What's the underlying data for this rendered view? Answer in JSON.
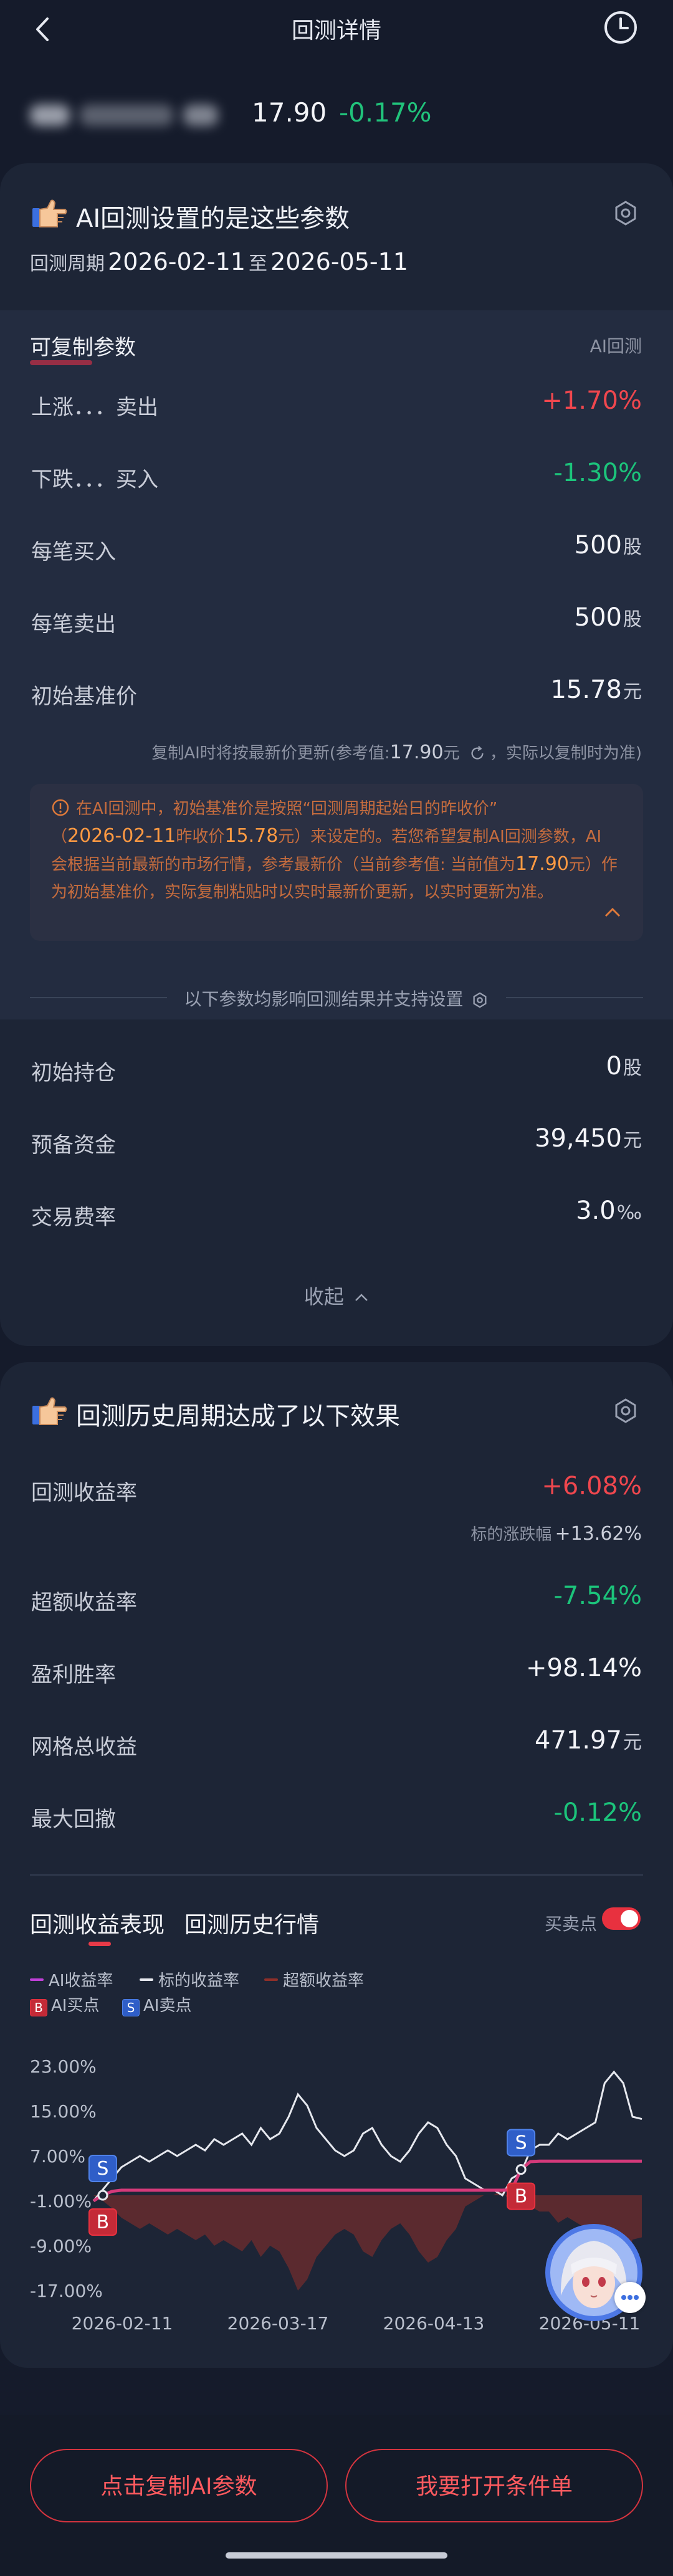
{
  "header": {
    "title": "回测详情"
  },
  "stock": {
    "price": "17.90",
    "change": "-0.17%"
  },
  "settings_card": {
    "title": "AI回测设置的是这些参数",
    "period_label": "回测周期",
    "period_start": "2026-02-11",
    "period_to": "至",
    "period_end": "2026-05-11",
    "copy_params_label": "可复制参数",
    "ai_tag": "AI回测",
    "rows": [
      {
        "label": "上涨．．．卖出",
        "value": "+1.70%",
        "unit": ""
      },
      {
        "label": "下跌．．．买入",
        "value": "-1.30%",
        "unit": ""
      },
      {
        "label": "每笔买入",
        "value": "500",
        "unit": "股"
      },
      {
        "label": "每笔卖出",
        "value": "500",
        "unit": "股"
      },
      {
        "label": "初始基准价",
        "value": "15.78",
        "unit": "元"
      }
    ],
    "ref_note_a": "复制AI时将按最新价更新(参考值:",
    "ref_note_value": "17.90",
    "ref_note_unit": "元",
    "ref_note_b": "，实际以复制时为准)",
    "notice": {
      "p1": "在AI回测中，初始基准价是按照“回测周期起始日的昨收价”",
      "p2_open": "（",
      "date": "2026-02-11",
      "p2_mid": "昨收价",
      "price": "15.78",
      "p2_tail": "元）来设定的。若您希望复制AI回测参数，AI",
      "p3": "会根据当前最新的市场行情，参考最新价（当前参考值: 当前值为",
      "ref": "17.90",
      "p3_tail": "元）作",
      "p4": "为初始基准价，实际复制粘贴时以实时最新价更新，以实时更新为准。"
    },
    "divider_text": "以下参数均影响回测结果并支持设置",
    "rows2": [
      {
        "label": "初始持仓",
        "value": "0",
        "unit": "股"
      },
      {
        "label": "预备资金",
        "value": "39,450",
        "unit": "元"
      },
      {
        "label": "交易费率",
        "value": "3.0",
        "unit": "‰"
      }
    ],
    "collapse_label": "收起"
  },
  "result_card": {
    "title": "回测历史周期达成了以下效果",
    "return_label": "回测收益率",
    "return_value": "+6.08%",
    "benchmark_label": "标的涨跌幅",
    "benchmark_value": "+13.62%",
    "rows": [
      {
        "label": "超额收益率",
        "value": "-7.54%",
        "unit": ""
      },
      {
        "label": "盈利胜率",
        "value": "+98.14%",
        "unit": ""
      },
      {
        "label": "网格总收益",
        "value": "471.97",
        "unit": "元"
      },
      {
        "label": "最大回撤",
        "value": "-0.12%",
        "unit": ""
      }
    ],
    "tabs": [
      "回测收益表现",
      "回测历史行情"
    ],
    "toggle_label": "买卖点",
    "legend": {
      "ai_return": "AI收益率",
      "stock_return": "标的收益率",
      "excess_return": "超额收益率",
      "buy": "AI买点",
      "sell": "AI卖点",
      "buy_glyph": "B",
      "sell_glyph": "S"
    }
  },
  "chart_data": {
    "type": "line",
    "y_ticks": [
      "23.00%",
      "15.00%",
      "7.00%",
      "-1.00%",
      "-9.00%",
      "-17.00%"
    ],
    "x_ticks": [
      "2026-02-11",
      "2026-03-17",
      "2026-04-13",
      "2026-05-11"
    ],
    "ylim": [
      -17,
      23
    ],
    "series": [
      {
        "name": "AI收益率",
        "color": "#c040d8",
        "values": [
          -1,
          0,
          0.7,
          0.9,
          0.9,
          0.9,
          0.9,
          0.9,
          0.9,
          0.9,
          0.9,
          0.9,
          0.9,
          0.9,
          0.9,
          0.9,
          0.9,
          0.9,
          0.9,
          0.9,
          0.9,
          0.9,
          0.9,
          0.9,
          0.9,
          0.9,
          0.9,
          0.9,
          0.9,
          0.9,
          0.9,
          0.9,
          0.9,
          0.9,
          0.9,
          0.9,
          0.9,
          0.9,
          0.9,
          0.9,
          0.9,
          0.9,
          0.9,
          0.9,
          0.9,
          1.0,
          4.6,
          6.0,
          6.08,
          6.08,
          6.08,
          6.08,
          6.08,
          6.08,
          6.08,
          6.08,
          6.08,
          6.08,
          6.08,
          6.08
        ]
      },
      {
        "name": "标的收益率",
        "color": "#e6e8ee",
        "values": [
          -1,
          1,
          3,
          5,
          6,
          7,
          6,
          7,
          8,
          7,
          8,
          9,
          8,
          10,
          9,
          10,
          11,
          9,
          12,
          10,
          11,
          14,
          18,
          16,
          12,
          10,
          8,
          7,
          8,
          11,
          12,
          9,
          7,
          6,
          8,
          11,
          13,
          12,
          9,
          7,
          3,
          2,
          1,
          1,
          0,
          3,
          4,
          8,
          9,
          9,
          11,
          10,
          11,
          12,
          13,
          20,
          22,
          20,
          14,
          13.6
        ]
      },
      {
        "name": "超额收益率",
        "color": "#8e2f2a",
        "values": [
          0,
          -1,
          -2.3,
          -4,
          -5,
          -6,
          -5,
          -6,
          -7,
          -6,
          -7,
          -8,
          -7,
          -9,
          -8,
          -9,
          -10,
          -8,
          -11,
          -9,
          -10,
          -13,
          -17,
          -15,
          -11,
          -9,
          -7,
          -6,
          -7,
          -10,
          -11,
          -8,
          -6,
          -5,
          -7,
          -10,
          -12,
          -11,
          -8,
          -6,
          -2,
          -1,
          0,
          0,
          1,
          -2,
          0.6,
          -2,
          -2.9,
          -2.9,
          -4.9,
          -3.9,
          -4.9,
          -5.9,
          -6.9,
          -13.9,
          -15.9,
          -13.9,
          -7.9,
          -7.5
        ]
      }
    ],
    "trade_points": [
      {
        "type": "sell",
        "index": 1
      },
      {
        "type": "buy",
        "index": 1
      },
      {
        "type": "sell",
        "index": 46
      },
      {
        "type": "buy",
        "index": 46
      }
    ]
  },
  "bottom": {
    "copy_button": "点击复制AI参数",
    "condition_button": "我要打开条件单"
  }
}
